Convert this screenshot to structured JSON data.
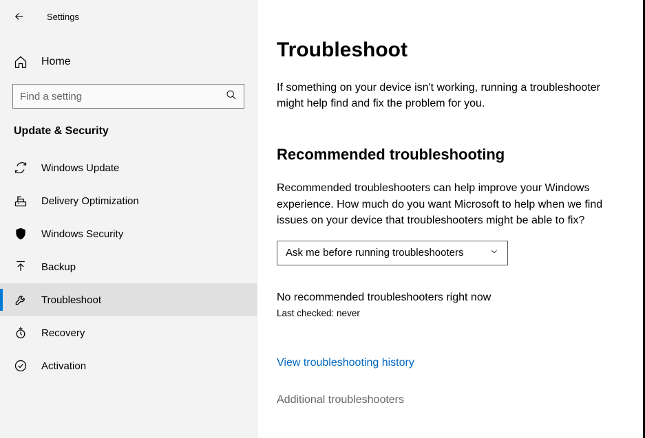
{
  "header": {
    "title": "Settings"
  },
  "sidebar": {
    "home_label": "Home",
    "search_placeholder": "Find a setting",
    "section_label": "Update & Security",
    "items": [
      {
        "label": "Windows Update",
        "icon": "sync-icon"
      },
      {
        "label": "Delivery Optimization",
        "icon": "delivery-icon"
      },
      {
        "label": "Windows Security",
        "icon": "shield-icon"
      },
      {
        "label": "Backup",
        "icon": "backup-icon"
      },
      {
        "label": "Troubleshoot",
        "icon": "wrench-icon",
        "selected": true
      },
      {
        "label": "Recovery",
        "icon": "recovery-icon"
      },
      {
        "label": "Activation",
        "icon": "check-circle-icon"
      }
    ]
  },
  "main": {
    "title": "Troubleshoot",
    "intro": "If something on your device isn't working, running a troubleshooter might help find and fix the problem for you.",
    "subsection_title": "Recommended troubleshooting",
    "subsection_text": "Recommended troubleshooters can help improve your Windows experience. How much do you want Microsoft to help when we find issues on your device that troubleshooters might be able to fix?",
    "dropdown_value": "Ask me before running troubleshooters",
    "no_recommended": "No recommended troubleshooters right now",
    "last_checked": "Last checked: never",
    "history_link": "View troubleshooting history",
    "additional": "Additional troubleshooters"
  }
}
